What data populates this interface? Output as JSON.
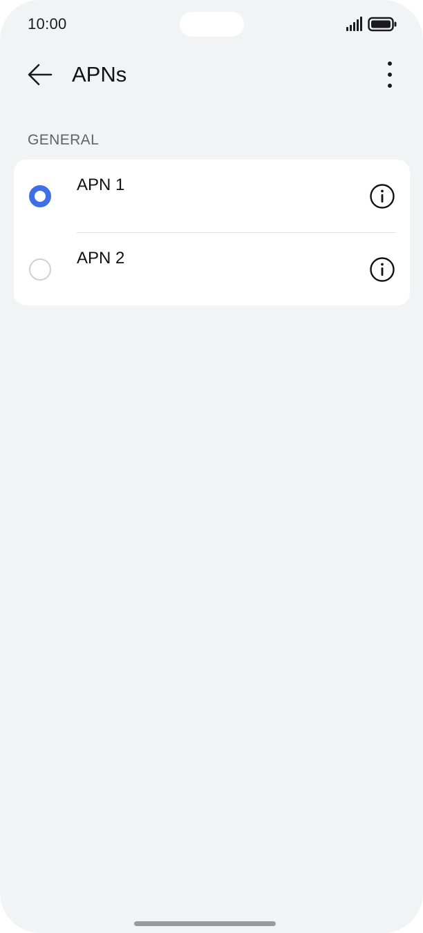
{
  "status_bar": {
    "time": "10:00",
    "signal_icon": "cellular-signal-icon",
    "battery_icon": "battery-full-icon"
  },
  "app_bar": {
    "title": "APNs",
    "back_icon": "arrow-left-icon",
    "more_icon": "more-vertical-icon"
  },
  "section": {
    "header": "GENERAL"
  },
  "apn_list": [
    {
      "label": "APN 1",
      "selected": true,
      "info_icon": "info-circle-icon"
    },
    {
      "label": "APN 2",
      "selected": false,
      "info_icon": "info-circle-icon"
    }
  ],
  "colors": {
    "accent": "#3e6fe5",
    "background": "#f2f3f5",
    "card": "#ffffff",
    "text_primary": "#111111",
    "text_secondary": "#5f6368"
  }
}
